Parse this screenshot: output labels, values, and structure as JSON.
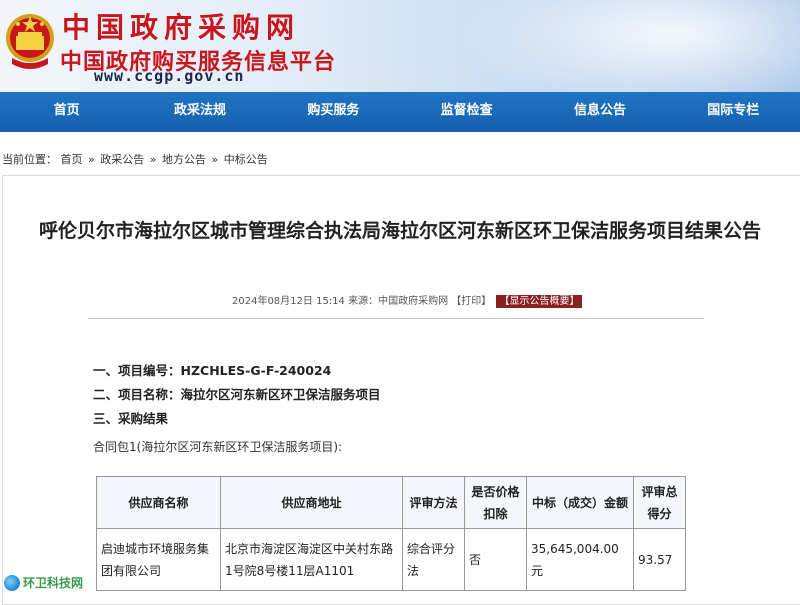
{
  "header": {
    "site_title": "中国政府采购网",
    "site_subtitle": "中国政府购买服务信息平台",
    "site_url": "www.ccgp.gov.cn"
  },
  "nav": {
    "items": [
      {
        "label": "首页"
      },
      {
        "label": "政采法规"
      },
      {
        "label": "购买服务"
      },
      {
        "label": "监督检查"
      },
      {
        "label": "信息公告"
      },
      {
        "label": "国际专栏"
      }
    ]
  },
  "breadcrumb": {
    "prefix": "当前位置：",
    "items": [
      "首页",
      "政采公告",
      "地方公告",
      "中标公告"
    ],
    "separator": "»"
  },
  "article": {
    "title": "呼伦贝尔市海拉尔区城市管理综合执法局海拉尔区河东新区环卫保洁服务项目结果公告",
    "meta_date": "2024年08月12日 15:14",
    "meta_source": "来源：中国政府采购网",
    "print_label": "【打印】",
    "summary_label": "【显示公告概要】",
    "sections": [
      {
        "label": "一、项目编号：",
        "value": "HZCHLES-G-F-240024"
      },
      {
        "label": "二、项目名称：",
        "value": "海拉尔区河东新区环卫保洁服务项目"
      },
      {
        "label": "三、采购结果",
        "value": ""
      }
    ],
    "package_line": "合同包1(海拉尔区河东新区环卫保洁服务项目):"
  },
  "table": {
    "headers": [
      "供应商名称",
      "供应商地址",
      "评审方法",
      "是否价格扣除",
      "中标（成交）金额",
      "评审总得分"
    ],
    "rows": [
      [
        "启迪城市环境服务集团有限公司",
        "北京市海淀区海淀区中关村东路1号院8号楼11层A1101",
        "综合评分法",
        "否",
        "35,645,004.00元",
        "93.57"
      ]
    ]
  },
  "watermark": {
    "text": "环卫科技网"
  },
  "colors": {
    "brand_red": "#c8161d",
    "nav_blue": "#1f74c4",
    "summary_bg": "#8c1f1f"
  }
}
